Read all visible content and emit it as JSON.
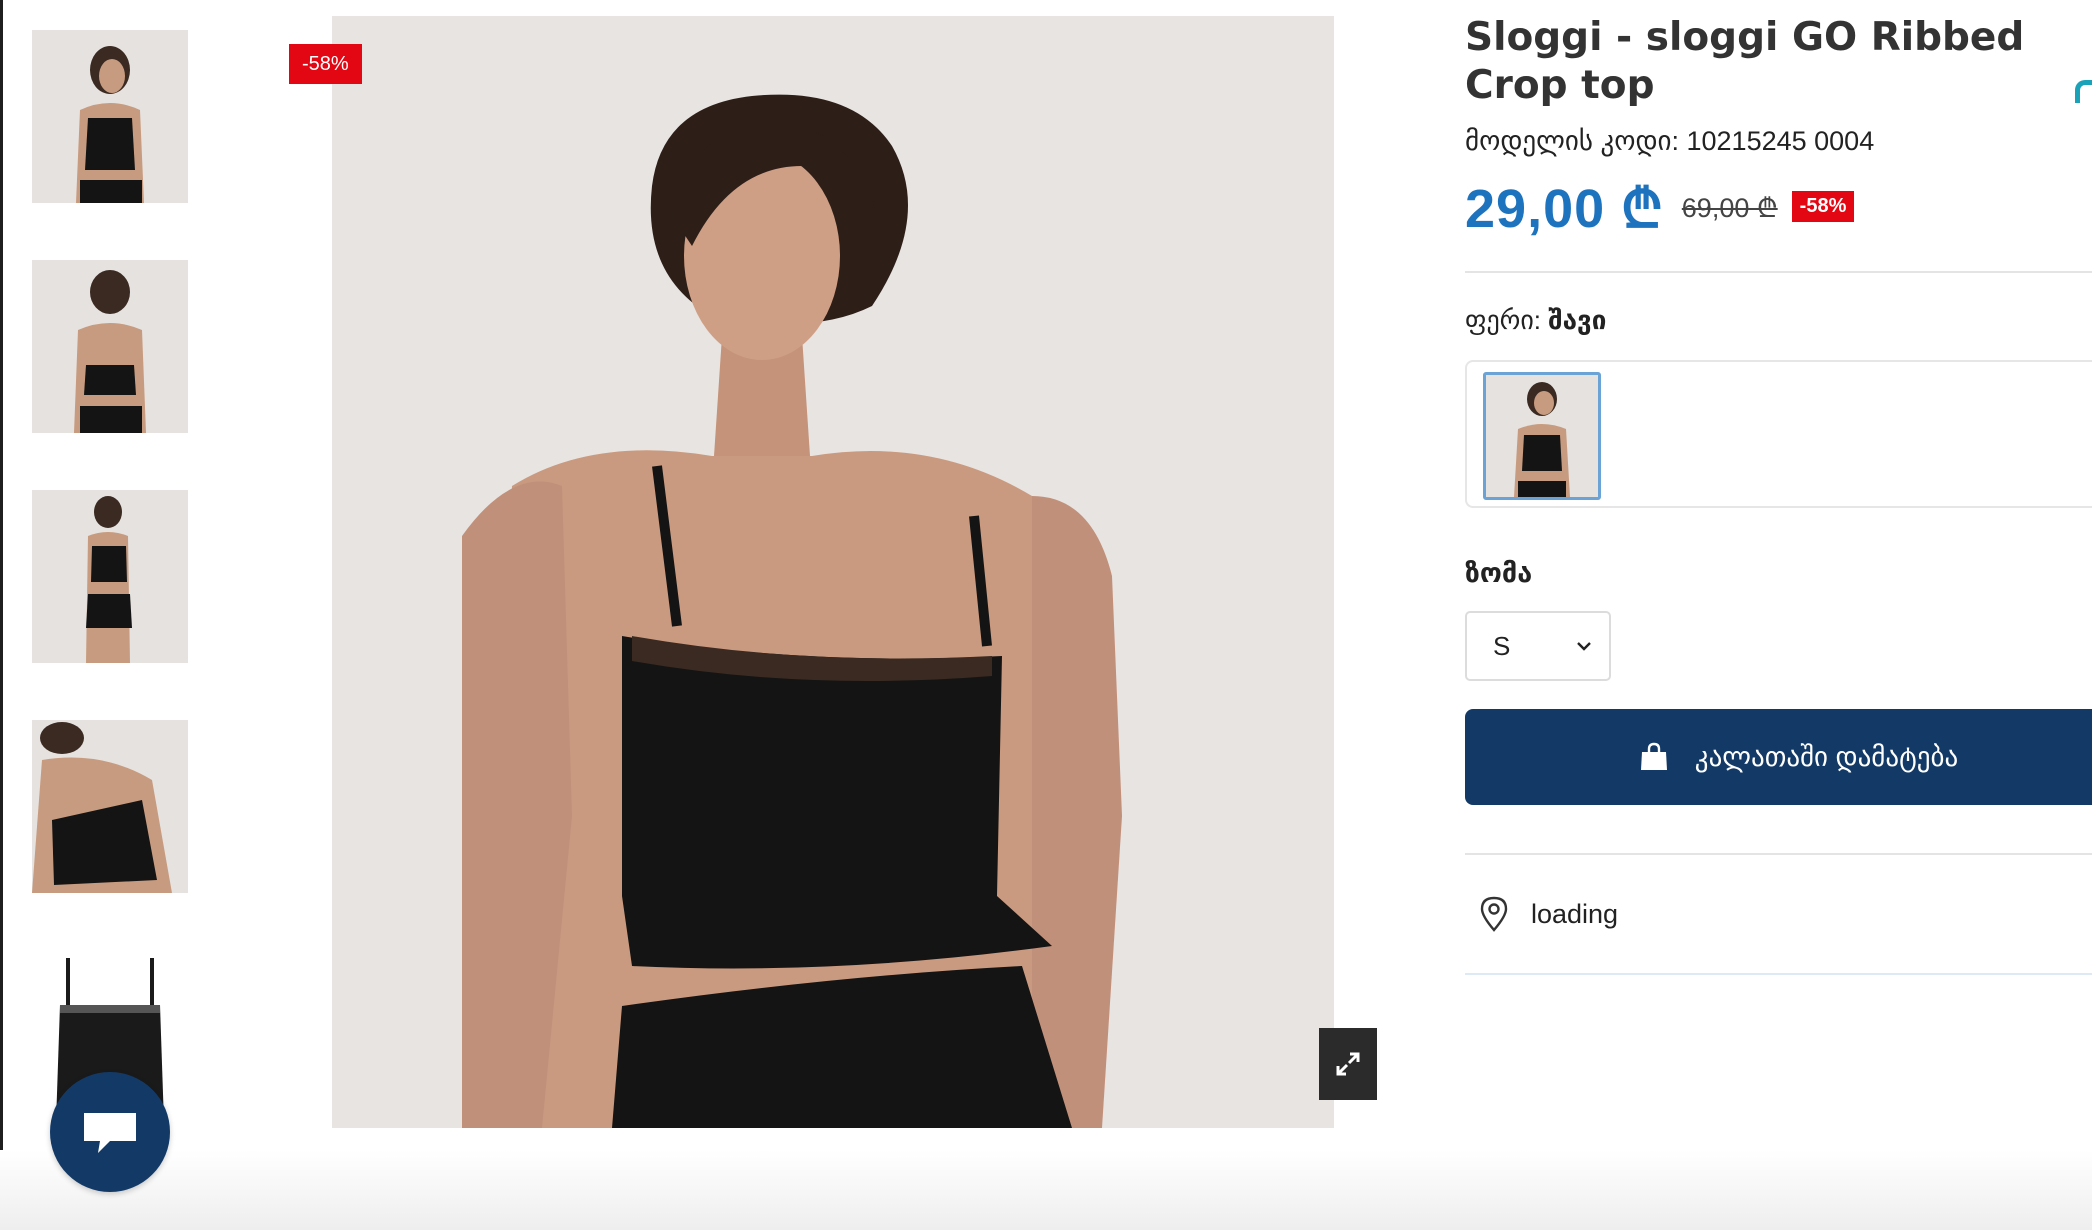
{
  "gallery": {
    "discount_flag": "-58%",
    "thumbnails": [
      "front-view",
      "back-view",
      "full-outfit",
      "detail-pose",
      "product-only"
    ]
  },
  "product": {
    "title": "Sloggi - sloggi GO Ribbed Crop top",
    "model_code": "მოდელის კოდი: 10215245 0004",
    "price_now": "29,00 ₾",
    "price_old": "69,00 ₾",
    "discount_badge": "-58%",
    "color_label": "ფერი:",
    "color_value": "შავი",
    "size_label": "ზომა",
    "size_selected": "S",
    "add_to_cart": "კალათაში დამატება",
    "location_status": "loading"
  },
  "colors": {
    "accent_blue": "#1e73be",
    "primary_navy": "#133a66",
    "sale_red": "#e30613"
  }
}
